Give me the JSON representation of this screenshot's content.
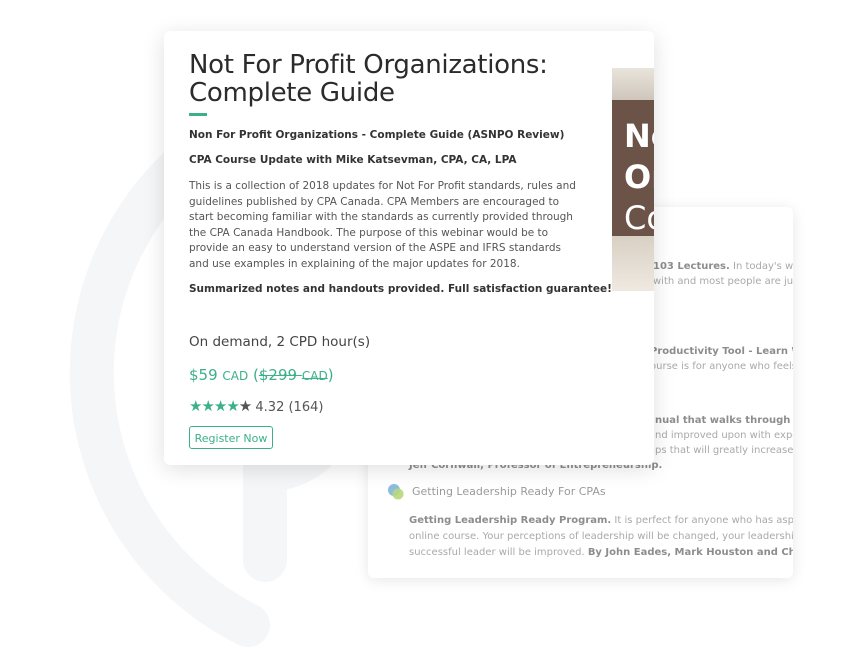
{
  "front": {
    "title": "Not For Profit Organizations: Complete Guide",
    "subtitle1": "Non For Profit Organizations - Complete Guide (ASNPO Review)",
    "subtitle2": "CPA Course Update with Mike Katsevman, CPA, CA, LPA",
    "description": "This is a collection of 2018 updates for Not For Profit standards, rules and guidelines published by CPA Canada. CPA Members are encouraged to start becoming familiar with the standards as currently provided through the CPA Canada Handbook. The purpose of this webinar would be to provide an easy to understand version of the ASPE and IFRS standards and use examples in explaining of the major updates for 2018.",
    "guarantee": "Summarized notes and handouts provided. Full satisfaction guarantee!",
    "on_demand": "On demand, 2 CPD hour(s)",
    "price": "$59",
    "price_currency": "CAD",
    "price_open": "(",
    "old_price": "$299",
    "old_currency": "CAD",
    "price_close": ")",
    "stars": "★★★★",
    "half_star": "★",
    "rating": "4.32",
    "reviews": "(164)",
    "register_label": "Register Now",
    "thumb_line1": "No",
    "thumb_line2": "Or",
    "thumb_line3": "Co"
  },
  "back": {
    "item1_bold": "103 Lectures.",
    "item1_rest": " In today's work",
    "item1_line2": "with and most people are just",
    "item2_bold": "Productivity Tool - Learn Why",
    "item2_line2": "ourse is for anyone who feels c",
    "item3_bold": "nual that walks through the",
    "item3_line2": "nd improved upon with exper",
    "item3_line3": "ps that will greatly increase the",
    "item3_author": "Jeff Cornwall, Professor of Entrepreneurship.",
    "lead_title": "Getting Leadership Ready For CPAs",
    "lead_bold": "Getting Leadership Ready Program.",
    "lead_rest": " It is perfect for anyone who has aspiration o",
    "lead_line2": "online course. Your perceptions of leadership will be changed, your leadership ski",
    "lead_line3": "successful leader will be improved. ",
    "lead_authors": "By John Eades, Mark Houston and Christina"
  },
  "colors": {
    "accent": "#3bb08a",
    "text_dark": "#2b2b2b",
    "muted": "#a9a9a9"
  }
}
